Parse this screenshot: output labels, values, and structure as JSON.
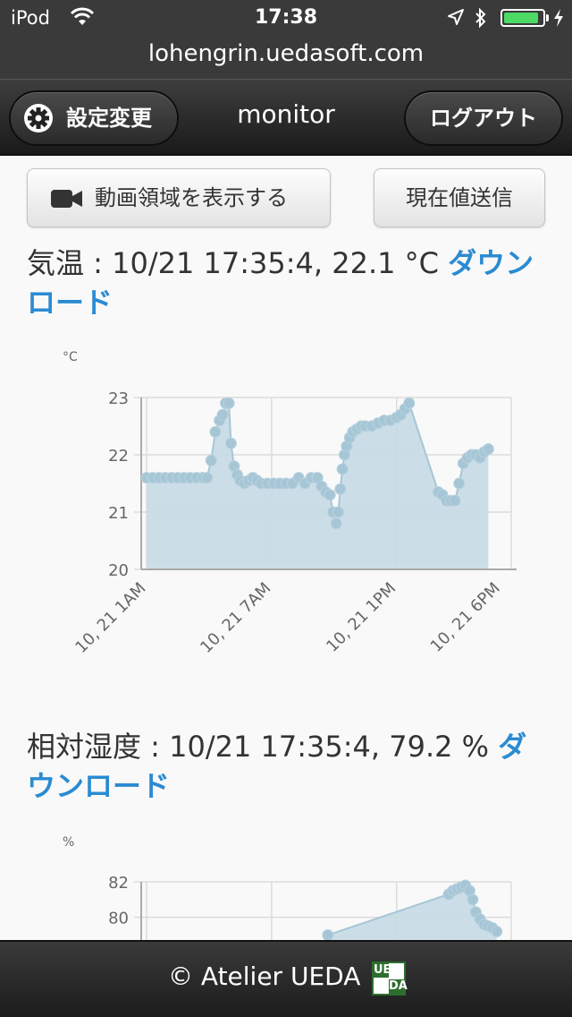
{
  "status_bar": {
    "carrier": "iPod",
    "time": "17:38",
    "battery_level": 0.9
  },
  "url_bar": {
    "domain": "lohengrin.uedasoft.com"
  },
  "header": {
    "settings_label": "設定変更",
    "title": "monitor",
    "logout_label": "ログアウト"
  },
  "toolbar": {
    "show_video_label": "動画領域を表示する",
    "send_current_label": "現在値送信"
  },
  "temperature": {
    "heading": "気温 : 10/21 17:35:4, 22.1 °C ",
    "download_label": "ダウンロード"
  },
  "humidity": {
    "heading": "相対湿度 : 10/21 17:35:4, 79.2 % ",
    "download_label": "ダウンロード"
  },
  "footer": {
    "text": "© Atelier UEDA",
    "logo_top": "UE",
    "logo_bottom": "DA"
  },
  "colors": {
    "series_fill": "#c5dae6",
    "series_point": "#a6c6d6",
    "link": "#2a8bd2"
  },
  "chart_data": [
    {
      "type": "area",
      "ylabel": "°C",
      "ylim": [
        20,
        23
      ],
      "yticks": [
        20,
        21,
        22,
        23
      ],
      "xlim": [
        1,
        18.5
      ],
      "xticks": [
        {
          "x": 1,
          "label": "10, 21 1AM"
        },
        {
          "x": 7,
          "label": "10, 21 7AM"
        },
        {
          "x": 13,
          "label": "10, 21 1PM"
        },
        {
          "x": 18,
          "label": "10, 21 6PM"
        }
      ],
      "x_unit": "hour of day (10/21)",
      "points": [
        [
          1.0,
          21.6
        ],
        [
          1.3,
          21.6
        ],
        [
          1.6,
          21.6
        ],
        [
          1.9,
          21.6
        ],
        [
          2.2,
          21.6
        ],
        [
          2.5,
          21.6
        ],
        [
          2.8,
          21.6
        ],
        [
          3.1,
          21.6
        ],
        [
          3.4,
          21.6
        ],
        [
          3.7,
          21.6
        ],
        [
          3.9,
          21.6
        ],
        [
          4.1,
          21.9
        ],
        [
          4.3,
          22.4
        ],
        [
          4.5,
          22.6
        ],
        [
          4.65,
          22.7
        ],
        [
          4.8,
          22.9
        ],
        [
          4.95,
          22.9
        ],
        [
          5.05,
          22.2
        ],
        [
          5.2,
          21.8
        ],
        [
          5.35,
          21.65
        ],
        [
          5.5,
          21.55
        ],
        [
          5.7,
          21.5
        ],
        [
          5.9,
          21.55
        ],
        [
          6.1,
          21.6
        ],
        [
          6.3,
          21.55
        ],
        [
          6.5,
          21.5
        ],
        [
          6.8,
          21.5
        ],
        [
          7.1,
          21.5
        ],
        [
          7.4,
          21.5
        ],
        [
          7.7,
          21.5
        ],
        [
          8.0,
          21.5
        ],
        [
          8.3,
          21.6
        ],
        [
          8.6,
          21.5
        ],
        [
          8.9,
          21.6
        ],
        [
          9.2,
          21.6
        ],
        [
          9.4,
          21.45
        ],
        [
          9.6,
          21.35
        ],
        [
          9.8,
          21.3
        ],
        [
          9.95,
          21.0
        ],
        [
          10.1,
          20.8
        ],
        [
          10.2,
          21.0
        ],
        [
          10.3,
          21.4
        ],
        [
          10.4,
          21.75
        ],
        [
          10.5,
          22.0
        ],
        [
          10.6,
          22.15
        ],
        [
          10.75,
          22.3
        ],
        [
          10.9,
          22.4
        ],
        [
          11.1,
          22.45
        ],
        [
          11.3,
          22.5
        ],
        [
          11.5,
          22.5
        ],
        [
          11.8,
          22.5
        ],
        [
          12.1,
          22.55
        ],
        [
          12.4,
          22.6
        ],
        [
          12.7,
          22.6
        ],
        [
          13.0,
          22.65
        ],
        [
          13.2,
          22.7
        ],
        [
          13.4,
          22.8
        ],
        [
          13.6,
          22.9
        ],
        [
          15.0,
          21.35
        ],
        [
          15.2,
          21.3
        ],
        [
          15.4,
          21.2
        ],
        [
          15.6,
          21.2
        ],
        [
          15.8,
          21.2
        ],
        [
          16.0,
          21.5
        ],
        [
          16.2,
          21.85
        ],
        [
          16.4,
          21.95
        ],
        [
          16.6,
          22.0
        ],
        [
          16.8,
          22.0
        ],
        [
          17.0,
          21.95
        ],
        [
          17.2,
          22.05
        ],
        [
          17.4,
          22.1
        ]
      ]
    },
    {
      "type": "area",
      "ylabel": "%",
      "ylim_visible": [
        78,
        82
      ],
      "yticks": [
        80,
        82
      ],
      "xlim": [
        1,
        18.5
      ],
      "x_unit": "hour of day (10/21)",
      "points": [
        [
          9.5,
          78.3
        ],
        [
          9.7,
          79.0
        ],
        [
          15.5,
          81.3
        ],
        [
          15.7,
          81.5
        ],
        [
          15.9,
          81.6
        ],
        [
          16.1,
          81.7
        ],
        [
          16.3,
          81.8
        ],
        [
          16.5,
          81.5
        ],
        [
          16.65,
          81.0
        ],
        [
          16.8,
          80.3
        ],
        [
          17.0,
          79.9
        ],
        [
          17.2,
          79.6
        ],
        [
          17.4,
          79.5
        ],
        [
          17.6,
          79.4
        ],
        [
          17.8,
          79.2
        ]
      ]
    }
  ]
}
